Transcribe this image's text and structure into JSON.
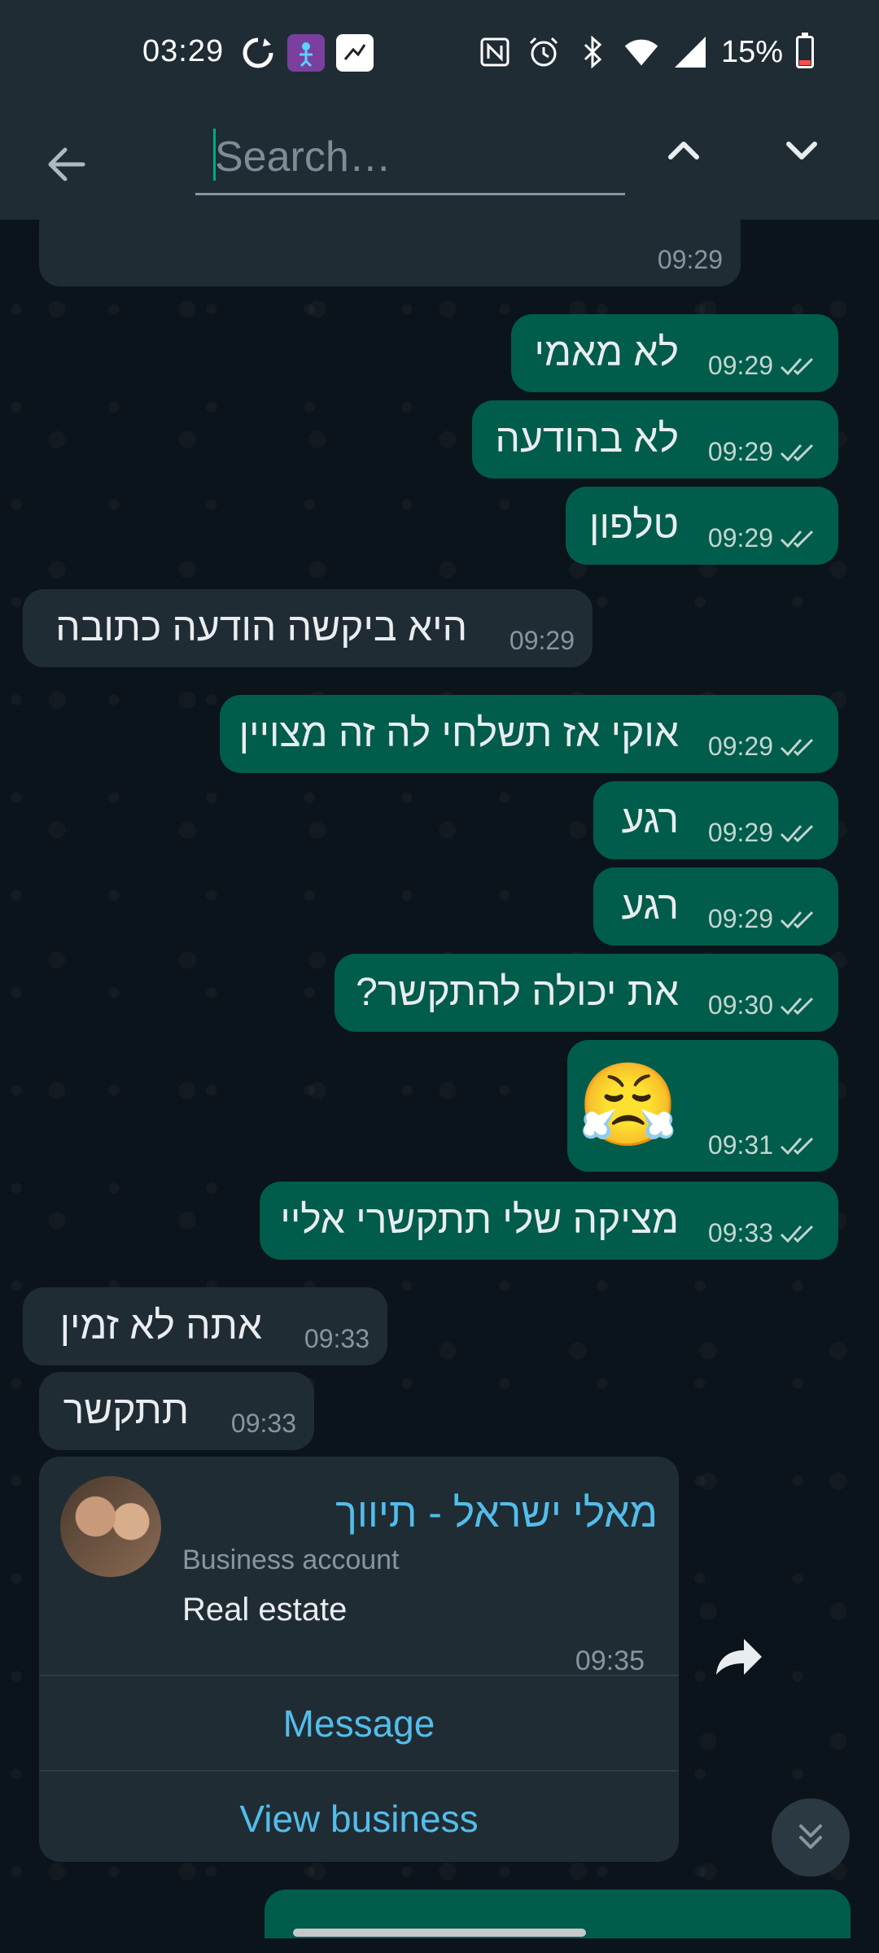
{
  "status_bar": {
    "time": "03:29",
    "battery": "15%"
  },
  "search": {
    "placeholder": "Search…"
  },
  "top_message": {
    "time": "09:29"
  },
  "messages": [
    {
      "dir": "out",
      "text": "לא מאמי",
      "time": "09:29"
    },
    {
      "dir": "out",
      "text": "לא בהודעה",
      "time": "09:29"
    },
    {
      "dir": "out",
      "text": "טלפון",
      "time": "09:29"
    },
    {
      "dir": "in",
      "text": "היא ביקשה הודעה כתובה",
      "time": "09:29"
    },
    {
      "dir": "out",
      "text": "אוקי אז תשלחי לה זה מצויין",
      "time": "09:29"
    },
    {
      "dir": "out",
      "text": "רגע",
      "time": "09:29"
    },
    {
      "dir": "out",
      "text": "רגע",
      "time": "09:29"
    },
    {
      "dir": "out",
      "text": "את יכולה להתקשר?",
      "time": "09:30"
    },
    {
      "dir": "out",
      "text": "😤",
      "time": "09:31"
    },
    {
      "dir": "out",
      "text": "מציקה שלי תתקשרי אליי",
      "time": "09:33"
    },
    {
      "dir": "in",
      "text": "אתה לא זמין",
      "time": "09:33"
    },
    {
      "dir": "in",
      "text": "תתקשר",
      "time": "09:33"
    }
  ],
  "business_card": {
    "name": "מאלי ישראל - תיווך",
    "account_type": "Business account",
    "category": "Real estate",
    "time": "09:35",
    "message_label": "Message",
    "view_label": "View business"
  },
  "colors": {
    "outgoing": "#005c4b",
    "incoming": "#202c33",
    "accent_blue": "#53bdeb",
    "background": "#0b141a"
  }
}
